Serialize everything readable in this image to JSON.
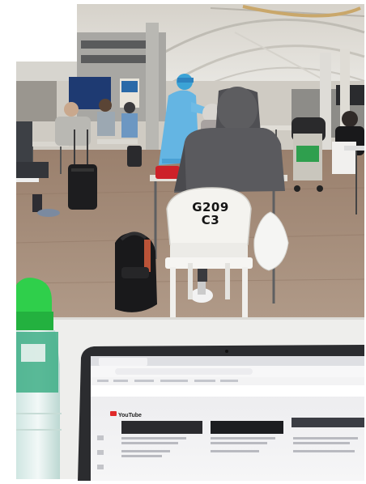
{
  "chair": {
    "row_code": "G209",
    "seat_code": "C3"
  },
  "laptop_screen": {
    "site_name": "YouTube"
  },
  "colors": {
    "floor": "#a08470",
    "ceiling": "#e6e2da",
    "bottle_cap": "#2fcf4b",
    "chair": "#f4f3ef",
    "hoodie": "#5d5d60"
  }
}
